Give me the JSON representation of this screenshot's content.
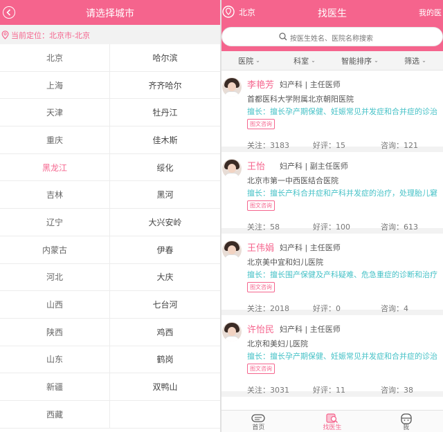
{
  "left": {
    "title": "请选择城市",
    "current_location": "当前定位：北京市-北京",
    "city_rows": [
      [
        "北京",
        "哈尔滨"
      ],
      [
        "上海",
        "齐齐哈尔"
      ],
      [
        "天津",
        "牡丹江"
      ],
      [
        "重庆",
        "佳木斯"
      ],
      [
        "黑龙江",
        "绥化"
      ],
      [
        "吉林",
        "黑河"
      ],
      [
        "辽宁",
        "大兴安岭"
      ],
      [
        "内蒙古",
        "伊春"
      ],
      [
        "河北",
        "大庆"
      ],
      [
        "山西",
        "七台河"
      ],
      [
        "陕西",
        "鸡西"
      ],
      [
        "山东",
        "鹤岗"
      ],
      [
        "新疆",
        "双鸭山"
      ],
      [
        "西藏",
        ""
      ]
    ],
    "selected_city": "黑龙江"
  },
  "right": {
    "city": "北京",
    "title": "找医生",
    "mine_label": "我的医",
    "search_placeholder": "按医生姓名、医院名称搜索",
    "filters": [
      "医院",
      "科室",
      "智能排序",
      "筛选"
    ],
    "doctors": [
      {
        "name": "李艳芳",
        "info": "妇产科 | 主任医师",
        "hospital": "首都医科大学附属北京朝阳医院",
        "specialty": "擅长：擅长孕产期保健、妊娠常见并发症和合并症的诊治",
        "tag": "图文咨询",
        "follow": "关注：3183",
        "rating": "好评：15",
        "consult": "咨询：121"
      },
      {
        "name": "王怡",
        "info": "妇产科 | 副主任医师",
        "hospital": "北京市第一中西医结合医院",
        "specialty": "擅长：擅长产科合并症和产科并发症的治疗，处理胎儿窘",
        "tag": "图文咨询",
        "follow": "关注：58",
        "rating": "好评：100",
        "consult": "咨询：613"
      },
      {
        "name": "王伟娟",
        "info": "妇产科 | 主任医师",
        "hospital": "北京美中宜和妇儿医院",
        "specialty": "擅长：擅长围产保健及产科疑难、危急重症的诊断和治疗",
        "tag": "图文咨询",
        "follow": "关注：2018",
        "rating": "好评：0",
        "consult": "咨询：4"
      },
      {
        "name": "许怡民",
        "info": "妇产科 | 主任医师",
        "hospital": "北京和美妇儿医院",
        "specialty": "擅长：擅长孕产期保健、妊娠常见并发症和合并症的诊治",
        "tag": "图文咨询",
        "follow": "关注：3031",
        "rating": "好评：11",
        "consult": "咨询：38"
      }
    ],
    "tabs": [
      "首页",
      "找医生",
      "我"
    ]
  },
  "colors": {
    "accent": "#f5648d",
    "specialty": "#46c2c7"
  }
}
